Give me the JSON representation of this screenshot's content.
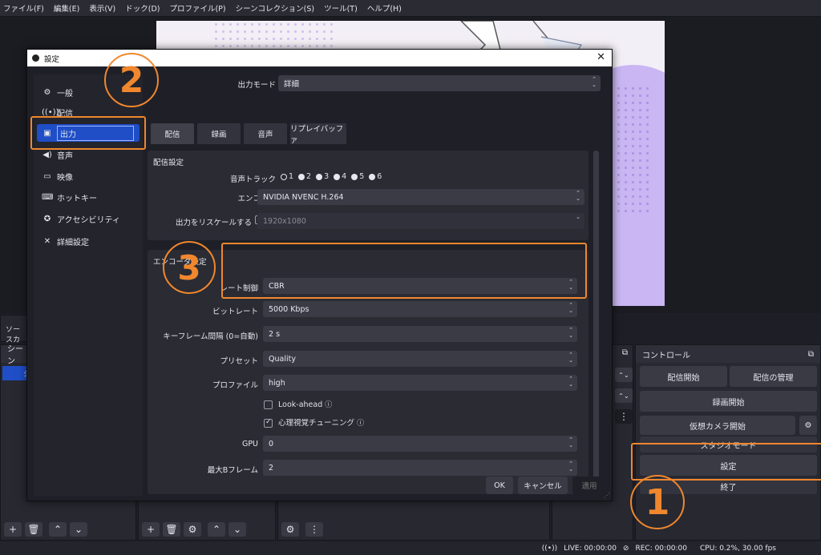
{
  "menubar": [
    "ファイル(F)",
    "編集(E)",
    "表示(V)",
    "ドック(D)",
    "プロファイル(P)",
    "シーンコレクション(S)",
    "ツール(T)",
    "ヘルプ(H)"
  ],
  "docks": {
    "source_label": "ソースカ",
    "scene_label": "シーン",
    "scene_item": "シ",
    "controls_title": "コントロール",
    "start_stream": "配信開始",
    "manage_stream": "配信の管理",
    "start_record": "録画開始",
    "start_vcam": "仮想カメラ開始",
    "studio_mode": "スタジオモード",
    "settings": "設定",
    "exit": "終了"
  },
  "status": {
    "live": "LIVE: 00:00:00",
    "rec": "REC: 00:00:00",
    "cpu": "CPU: 0.2%, 30.00 fps"
  },
  "dialog": {
    "title": "設定",
    "sidebar": [
      {
        "label": "一般",
        "icon": "gear-icon",
        "glyph": "⚙"
      },
      {
        "label": "配信",
        "icon": "broadcast-icon",
        "glyph": "((•))"
      },
      {
        "label": "出力",
        "icon": "output-icon",
        "glyph": "▣"
      },
      {
        "label": "音声",
        "icon": "audio-icon",
        "glyph": "◀)"
      },
      {
        "label": "映像",
        "icon": "monitor-icon",
        "glyph": "▭"
      },
      {
        "label": "ホットキー",
        "icon": "keyboard-icon",
        "glyph": "⌨"
      },
      {
        "label": "アクセシビリティ",
        "icon": "accessibility-icon",
        "glyph": "✪"
      },
      {
        "label": "詳細設定",
        "icon": "wrench-icon",
        "glyph": "✕"
      }
    ],
    "output_mode_label": "出力モード",
    "output_mode_value": "詳細",
    "tabs": [
      "配信",
      "録画",
      "音声",
      "リプレイバッファ"
    ],
    "stream_settings_title": "配信設定",
    "audio_track_label": "音声トラック",
    "audio_tracks": [
      "1",
      "2",
      "3",
      "4",
      "5",
      "6"
    ],
    "encoder_label": "エンコーダ",
    "encoder_value": "NVIDIA NVENC H.264",
    "rescale_label": "出力をリスケールする",
    "rescale_value": "1920x1080",
    "encoder_settings_title": "エンコーダ設定",
    "rate_control_label": "レート制御",
    "rate_control_value": "CBR",
    "bitrate_label": "ビットレート",
    "bitrate_value": "5000 Kbps",
    "keyframe_label": "キーフレーム間隔 (0=自動)",
    "keyframe_value": "2 s",
    "preset_label": "プリセット",
    "preset_value": "Quality",
    "profile_label": "プロファイル",
    "profile_value": "high",
    "lookahead_label": "Look-ahead",
    "psycho_label": "心理視覚チューニング",
    "gpu_label": "GPU",
    "gpu_value": "0",
    "bframes_label": "最大Bフレーム",
    "bframes_value": "2",
    "ok": "OK",
    "cancel": "キャンセル",
    "apply": "適用"
  },
  "annotations": {
    "one": "1",
    "two": "2",
    "three": "3"
  },
  "colors": {
    "accent": "#f0872e",
    "selection": "#1f4ec7"
  }
}
